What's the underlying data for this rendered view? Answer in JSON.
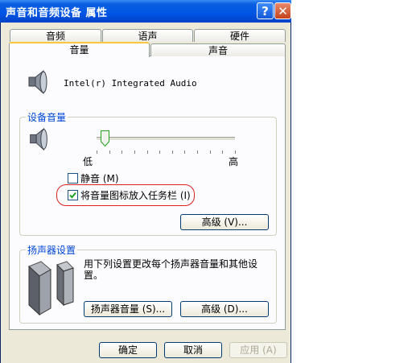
{
  "window": {
    "title": "声音和音频设备 属性"
  },
  "titlebar": {
    "help": "?",
    "close": "✕"
  },
  "tabs": {
    "row_back": [
      "音频",
      "语声",
      "硬件"
    ],
    "row_front": [
      "音量",
      "声音"
    ]
  },
  "device": {
    "name": "Intel(r) Integrated Audio",
    "icon": "speaker-icon"
  },
  "device_volume": {
    "group_label": "设备音量",
    "low_label": "低",
    "high_label": "高",
    "level": 0.06,
    "mute_label": "静音 (M)",
    "mute_checked": false,
    "taskbar_label": "将音量图标放入任务栏 (I)",
    "taskbar_checked": true,
    "advanced_button": "高级 (V)..."
  },
  "speaker_settings": {
    "group_label": "扬声器设置",
    "description": "用下列设置更改每个扬声器音量和其他设置。",
    "volume_button": "扬声器音量 (S)...",
    "advanced_button": "高级 (D)..."
  },
  "footer": {
    "ok": "确定",
    "cancel": "取消",
    "apply": "应用 (A)"
  },
  "colors": {
    "accent": "#0046d5",
    "highlight_ring": "#e02020",
    "titlebar": "#0055e5"
  }
}
